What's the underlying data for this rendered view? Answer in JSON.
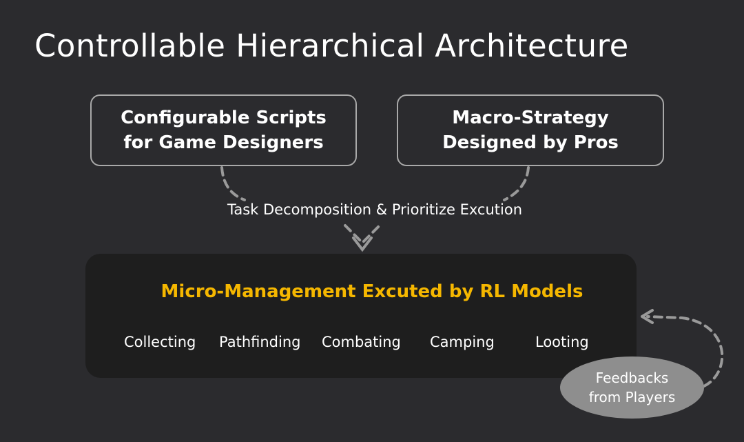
{
  "title": "Controllable Hierarchical Architecture",
  "box_left": {
    "line1": "Configurable Scripts",
    "line2": "for Game Designers"
  },
  "box_right": {
    "line1": "Macro-Strategy",
    "line2": "Designed by Pros"
  },
  "connector_label": "Task Decomposition & Prioritize Excution",
  "bottom": {
    "title": "Micro-Management Excuted by RL Models",
    "tasks": [
      "Collecting",
      "Pathfinding",
      "Combating",
      "Camping",
      "Looting"
    ]
  },
  "feedback": {
    "line1": "Feedbacks",
    "line2": "from Players"
  },
  "colors": {
    "background": "#2b2b2e",
    "panel": "#1e1e1e",
    "accent": "#f5b700",
    "border": "#a9a9a9",
    "dashed": "#9a9a9a",
    "ellipse": "#8e8e8e"
  }
}
